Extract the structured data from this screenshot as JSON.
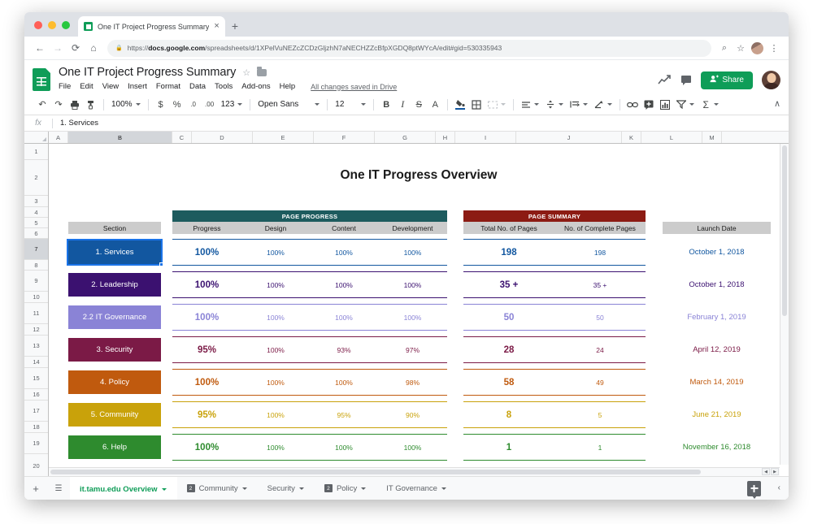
{
  "browser": {
    "tab": {
      "title": "One IT Project Progress Summary",
      "favicon": "sheets-favicon",
      "close_label": "×"
    },
    "new_tab_label": "+",
    "nav": {
      "back": "←",
      "forward": "→",
      "reload": "⟳",
      "home": "⌂"
    },
    "url": {
      "lock": "🔒",
      "scheme": "https://",
      "domain": "docs.google.com",
      "path": "/spreadsheets/d/1XPelVuNEZcZCDzGljzhN7aNECHZZcBfpXGDQ8ptWYcA/edit#gid=530335943",
      "full": "https://docs.google.com/spreadsheets/d/1XPelVuNEZcZCDzGljzhN7aNECHZZcBfpXGDQ8ptWYcA/edit#gid=530335943"
    },
    "omni_actions": {
      "search": "⌕",
      "star": "☆",
      "menu": "⋮"
    }
  },
  "app": {
    "logo": "sheets-logo",
    "doc_title": "One IT Project Progress Summary",
    "star_icon": "☆",
    "folder_icon": "folder-icon",
    "menus": [
      "File",
      "Edit",
      "View",
      "Insert",
      "Format",
      "Data",
      "Tools",
      "Add-ons",
      "Help"
    ],
    "save_status": "All changes saved in Drive",
    "actions": {
      "activity_icon": "activity-chart-icon",
      "comments_icon": "comment-icon",
      "share_label": "Share",
      "share_icon": "person-add-icon",
      "avatar": "user-avatar"
    }
  },
  "toolbar": {
    "undo": "↶",
    "redo": "↷",
    "print": "⎙",
    "paint_format": "✐",
    "zoom": "100%",
    "currency": "$",
    "percent": "%",
    "decrease_decimal": ".0",
    "increase_decimal": ".00",
    "more_formats": "123",
    "font_family": "Open Sans",
    "font_size": "12",
    "bold": "B",
    "italic": "I",
    "strikethrough": "S",
    "text_color": "A",
    "fill_color": "fill-color-icon",
    "borders": "borders-icon",
    "merge_cells": "merge-cells-icon",
    "horizontal_align": "align-icon",
    "vertical_align": "vertical-align-icon",
    "text_wrap": "text-wrap-icon",
    "text_rotation": "text-rotation-icon",
    "insert_link": "link-icon",
    "insert_comment": "add-comment-icon",
    "insert_chart": "chart-icon",
    "create_filter": "filter-icon",
    "functions": "Σ",
    "collapse": "∧"
  },
  "formula_bar": {
    "name_box": "fx",
    "value": "1. Services"
  },
  "grid": {
    "columns": [
      "A",
      "B",
      "C",
      "D",
      "E",
      "F",
      "G",
      "H",
      "I",
      "J",
      "K",
      "L",
      "M"
    ],
    "selected_column": "B",
    "rows": [
      "1",
      "2",
      "3",
      "4",
      "5",
      "6",
      "7",
      "8",
      "9",
      "10",
      "11",
      "12",
      "13",
      "14",
      "15",
      "16",
      "17",
      "18",
      "19",
      "20"
    ],
    "selected_row": "7"
  },
  "report": {
    "title": "One IT Progress Overview",
    "section_header": "Section",
    "launch_date_header": "Launch Date",
    "groups": [
      {
        "name": "PAGE PROGRESS",
        "color": "#1d5b5e",
        "columns": [
          "Progress",
          "Design",
          "Content",
          "Development"
        ]
      },
      {
        "name": "PAGE SUMMARY",
        "color": "#8c1b13",
        "columns": [
          "Total No. of Pages",
          "No. of Complete Pages"
        ]
      }
    ],
    "rows": [
      {
        "section": "1. Services",
        "color": "#1257a0",
        "selected": true,
        "progress": "100%",
        "design": "100%",
        "content": "100%",
        "development": "100%",
        "total_pages": "198",
        "complete_pages": "198",
        "launch_date": "October 1, 2018"
      },
      {
        "section": "2. Leadership",
        "color": "#3b1170",
        "selected": false,
        "progress": "100%",
        "design": "100%",
        "content": "100%",
        "development": "100%",
        "total_pages": "35 +",
        "complete_pages": "35 +",
        "launch_date": "October 1, 2018"
      },
      {
        "section": "2.2 IT Governance",
        "color": "#8a83d6",
        "selected": false,
        "progress": "100%",
        "design": "100%",
        "content": "100%",
        "development": "100%",
        "total_pages": "50",
        "complete_pages": "50",
        "launch_date": "February 1, 2019"
      },
      {
        "section": "3. Security",
        "color": "#7b1a46",
        "selected": false,
        "progress": "95%",
        "design": "100%",
        "content": "93%",
        "development": "97%",
        "total_pages": "28",
        "complete_pages": "24",
        "launch_date": "April 12, 2019"
      },
      {
        "section": "4. Policy",
        "color": "#c05a0e",
        "selected": false,
        "progress": "100%",
        "design": "100%",
        "content": "100%",
        "development": "98%",
        "total_pages": "58",
        "complete_pages": "49",
        "launch_date": "March 14, 2019"
      },
      {
        "section": "5. Community",
        "color": "#c9a20a",
        "selected": false,
        "progress": "95%",
        "design": "100%",
        "content": "95%",
        "development": "90%",
        "total_pages": "8",
        "complete_pages": "5",
        "launch_date": "June 21, 2019"
      },
      {
        "section": "6. Help",
        "color": "#2e8b2e",
        "selected": false,
        "progress": "100%",
        "design": "100%",
        "content": "100%",
        "development": "100%",
        "total_pages": "1",
        "complete_pages": "1",
        "launch_date": "November 16, 2018"
      }
    ]
  },
  "sheet_bar": {
    "add_sheet": "+",
    "all_sheets": "☰",
    "tabs": [
      {
        "label": "it.tamu.edu Overview",
        "active": true,
        "badge": null
      },
      {
        "label": "Community",
        "active": false,
        "badge": "2"
      },
      {
        "label": "Security",
        "active": false,
        "badge": null
      },
      {
        "label": "Policy",
        "active": false,
        "badge": "2"
      },
      {
        "label": "IT Governance",
        "active": false,
        "badge": null
      }
    ],
    "explore": "explore-icon",
    "collapse": "‹"
  }
}
